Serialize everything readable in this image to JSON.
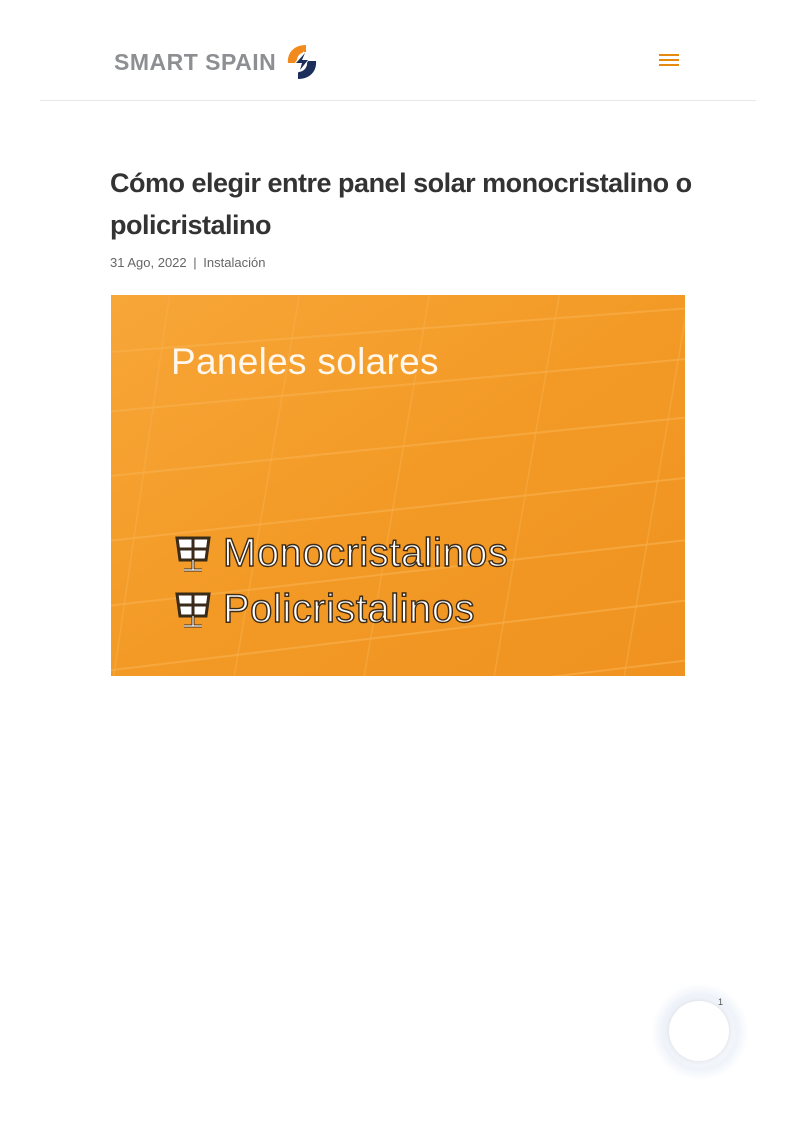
{
  "header": {
    "logo_text": "SMART SPAIN",
    "menu_icon": "hamburger-menu-icon"
  },
  "post": {
    "title": "Cómo elegir entre panel solar monocristalino o policristalino",
    "date": "31 Ago, 2022",
    "separator": "|",
    "category": "Instalación"
  },
  "featured_image": {
    "heading": "Paneles solares",
    "line1": "Monocristalinos",
    "line2": "Policristalinos",
    "icon": "solar-panel-icon",
    "background_color": "#f39a26"
  },
  "widget": {
    "badge": "1"
  },
  "colors": {
    "accent": "#e48a10",
    "logo_gray": "#8d8f93",
    "logo_blue": "#1c2f5a",
    "logo_orange": "#f28b1e"
  }
}
